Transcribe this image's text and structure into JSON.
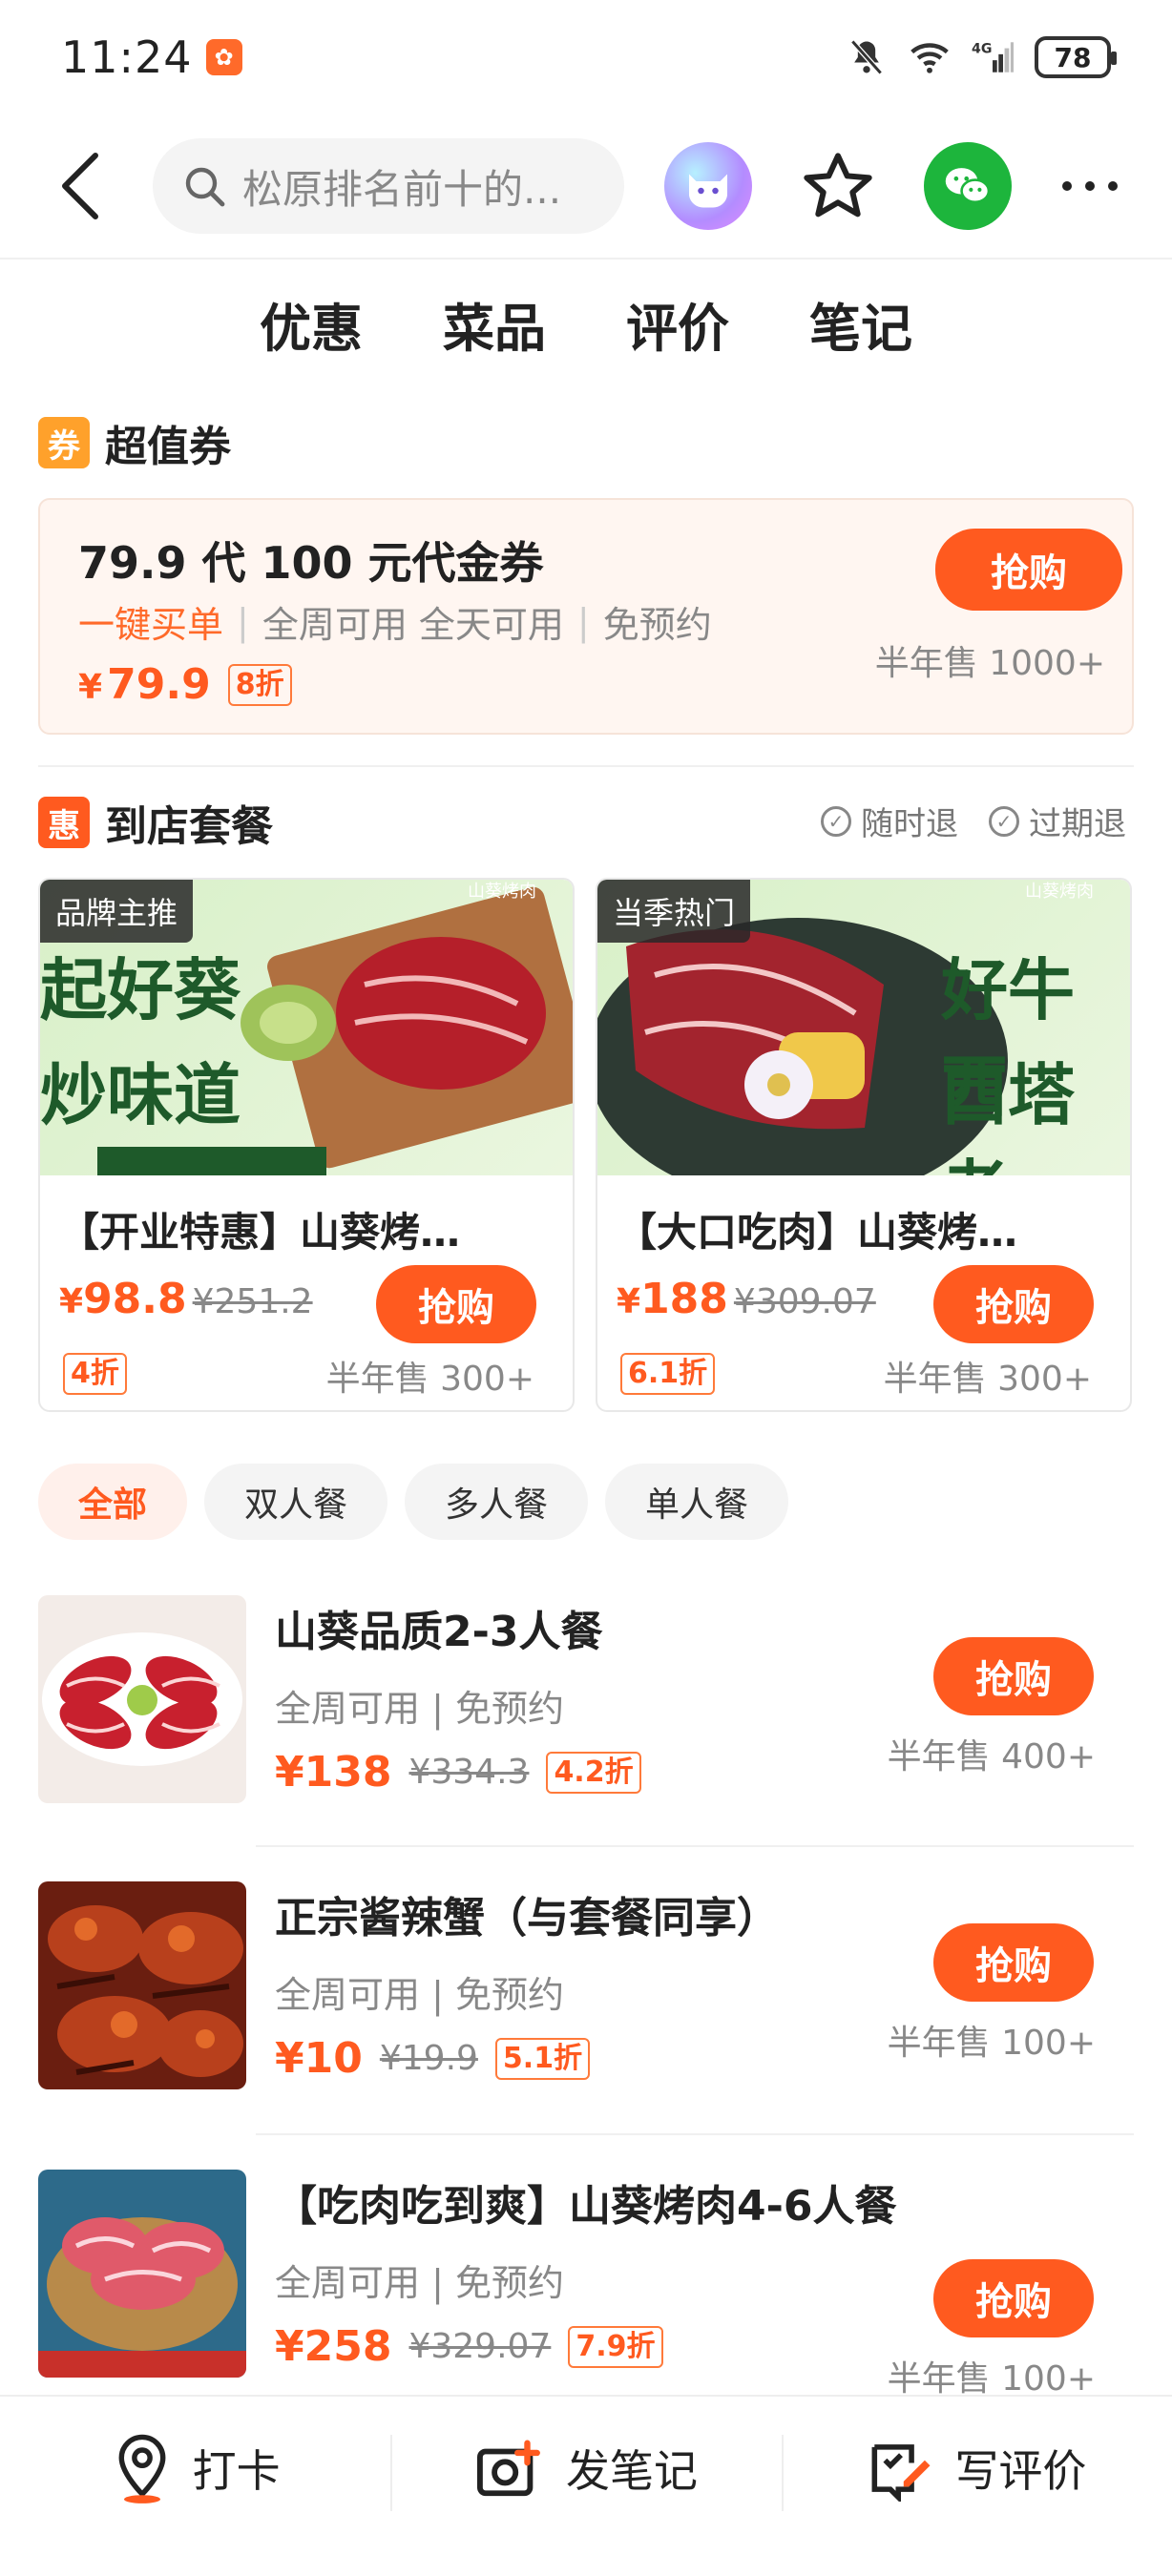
{
  "status": {
    "time": "11:24",
    "battery": "78",
    "network": "4G"
  },
  "nav": {
    "search_placeholder": "松原排名前十的..."
  },
  "tabs": [
    "优惠",
    "菜品",
    "评价",
    "笔记"
  ],
  "voucher_section": {
    "tag": "券",
    "title": "超值券",
    "card": {
      "title": "79.9 代 100 元代金券",
      "tag_accent": "一键买单",
      "tag_1": "全周可用 全天可用",
      "tag_2": "免预约",
      "currency": "¥",
      "price": "79.9",
      "discount": "8折",
      "buy": "抢购",
      "sold": "半年售 1000+"
    }
  },
  "package_section": {
    "tag": "惠",
    "title": "到店套餐",
    "refund_1": "随时退",
    "refund_2": "过期退",
    "cards": [
      {
        "label": "品牌主推",
        "img_text_1": "起好葵",
        "img_text_2": "炒味道",
        "name": "【开业特惠】山葵烤…",
        "currency": "¥",
        "price": "98.8",
        "orig": "¥251.2",
        "buy": "抢购",
        "discount": "4折",
        "sold": "半年售 300+"
      },
      {
        "label": "当季热门",
        "img_text_1": "好牛西",
        "img_text_2": "西塔老",
        "name": "【大口吃肉】山葵烤…",
        "currency": "¥",
        "price": "188",
        "orig": "¥309.07",
        "buy": "抢购",
        "discount": "6.1折",
        "sold": "半年售 300+"
      }
    ]
  },
  "filters": [
    "全部",
    "双人餐",
    "多人餐",
    "单人餐"
  ],
  "items": [
    {
      "title": "山葵品质2-3人餐",
      "sub": "全周可用 | 免预约",
      "price": "¥138",
      "orig": "¥334.3",
      "discount": "4.2折",
      "buy": "抢购",
      "sold": "半年售 400+"
    },
    {
      "title": "正宗酱辣蟹（与套餐同享）",
      "sub": "全周可用 | 免预约",
      "price": "¥10",
      "orig": "¥19.9",
      "discount": "5.1折",
      "buy": "抢购",
      "sold": "半年售 100+"
    },
    {
      "title": "【吃肉吃到爽】山葵烤肉4-6人餐",
      "sub": "全周可用 | 免预约",
      "price": "¥258",
      "orig": "¥329.07",
      "discount": "7.9折",
      "buy": "抢购",
      "sold": "半年售 100+"
    }
  ],
  "bottom": {
    "checkin": "打卡",
    "post_note": "发笔记",
    "write_review": "写评价"
  },
  "colors": {
    "accent": "#ff5a1f",
    "voucher_tag": "#ffa12b",
    "package_tag": "#ff5a1f",
    "wechat": "#1db53c"
  }
}
